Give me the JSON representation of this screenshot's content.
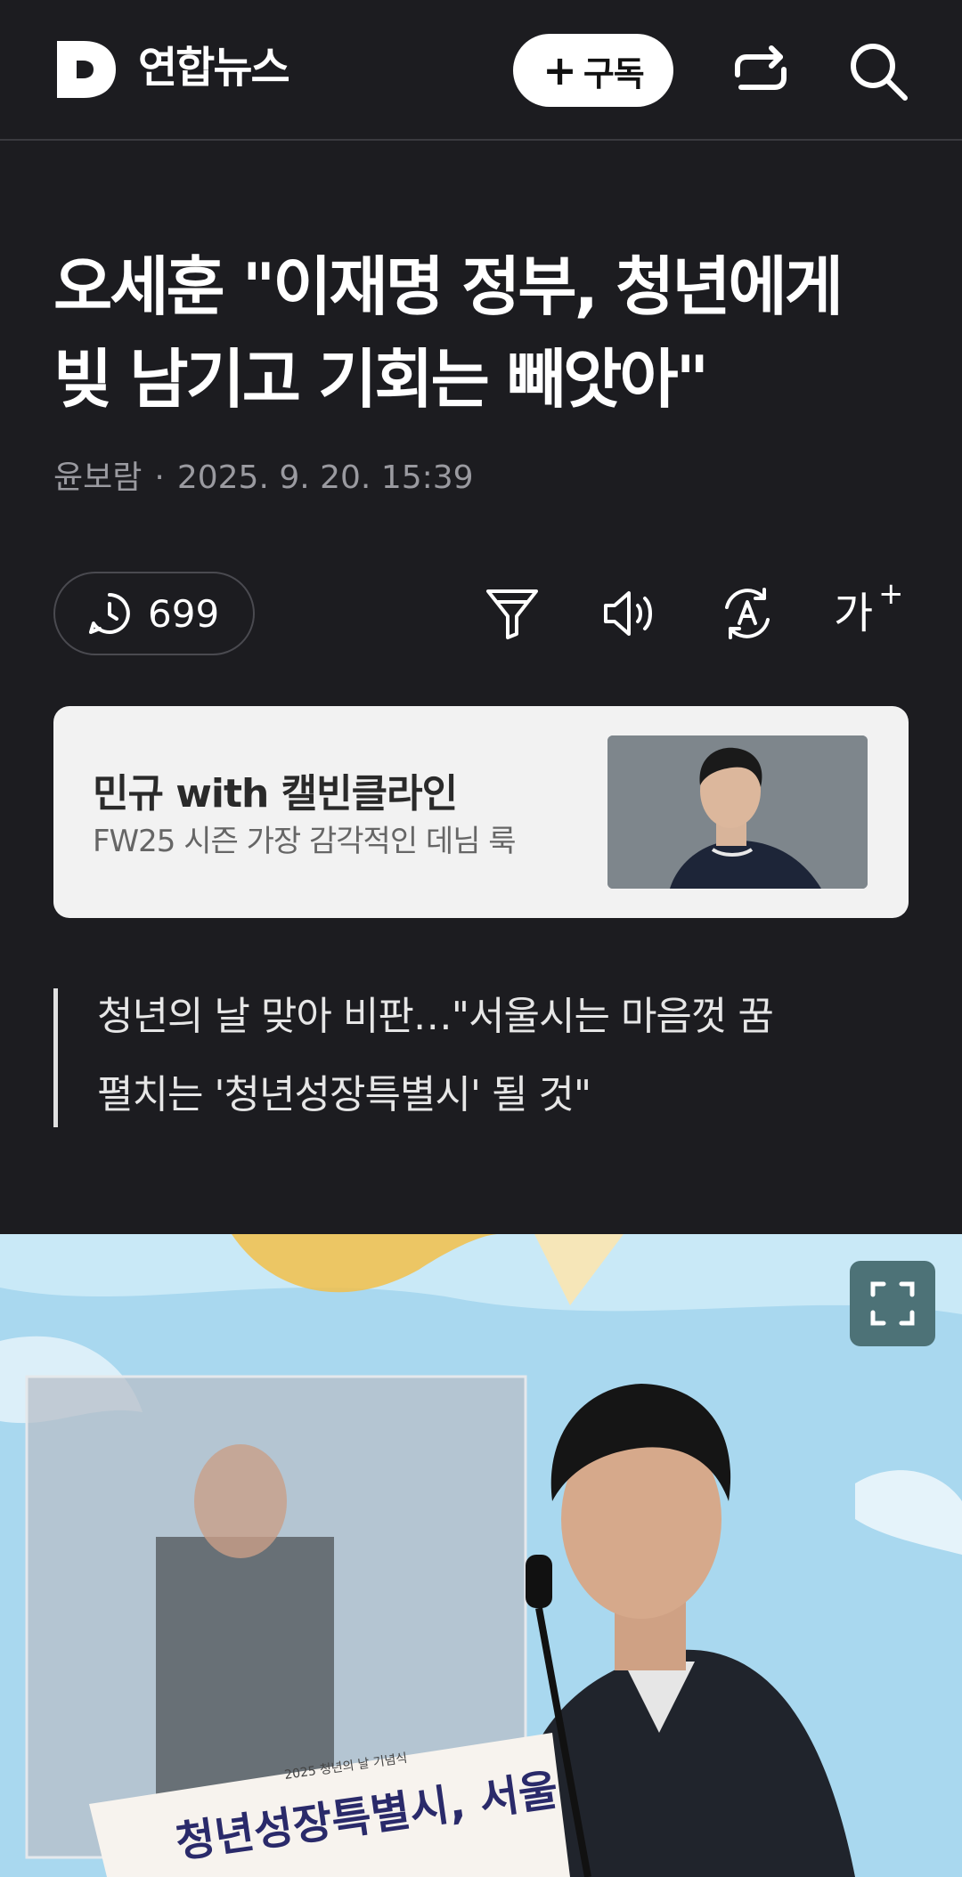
{
  "header": {
    "press_name": "연합뉴스",
    "subscribe_label": "구독",
    "icons": [
      "logo-d-icon",
      "share-icon",
      "search-icon"
    ]
  },
  "article": {
    "title_line1": "오세훈 \"이재명 정부, 청년에게",
    "title_line2": "빚 남기고 기회는 빼앗아\"",
    "author": "윤보람",
    "datetime": "2025. 9. 20. 15:39",
    "comment_count": "699",
    "summary_line1": "청년의 날 맞아 비판…\"서울시는 마음껏 꿈",
    "summary_line2": "펼치는 '청년성장특별시' 될 것\""
  },
  "toolbar": {
    "icons": [
      "comment-icon",
      "filter-icon",
      "speaker-icon",
      "translate-icon",
      "font-size-icon"
    ],
    "font_size_glyph": "가"
  },
  "ad": {
    "title": "민규 with 캘빈클라인",
    "description": "FW25 시즌 가장 감각적인 데님 룩"
  },
  "photo": {
    "banner_text": "청년성장특별시, 서울",
    "banner_small": "2025 청년의 날 기념식"
  },
  "colors": {
    "background": "#1c1c20",
    "text_primary": "#ffffff",
    "text_muted": "#9a9aa0",
    "ad_card": "#f2f2f2",
    "expand_button": "#4d7277"
  }
}
